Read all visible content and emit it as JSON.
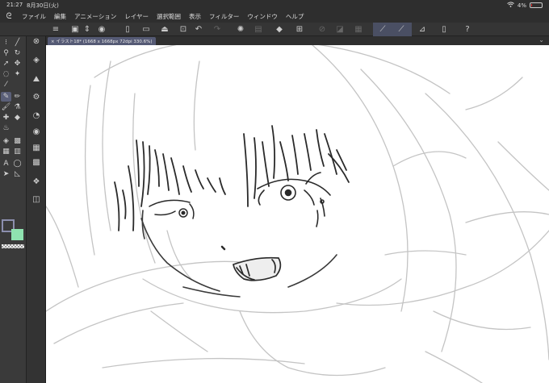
{
  "status": {
    "time": "21:27",
    "date": "8月30日(火)",
    "battery": "4%",
    "battery_level": 0.04
  },
  "menu": [
    {
      "id": "file",
      "label": "ファイル"
    },
    {
      "id": "edit",
      "label": "編集"
    },
    {
      "id": "animation",
      "label": "アニメーション"
    },
    {
      "id": "layer",
      "label": "レイヤー"
    },
    {
      "id": "selection",
      "label": "選択範囲"
    },
    {
      "id": "view",
      "label": "表示"
    },
    {
      "id": "filter",
      "label": "フィルター"
    },
    {
      "id": "window",
      "label": "ウィンドウ"
    },
    {
      "id": "help",
      "label": "ヘルプ"
    }
  ],
  "document_tab": {
    "label": "イラスト18* (1668 x 1668px 72dpi 330.6%)",
    "close_glyph": "×"
  },
  "colors": {
    "main": "#3a3a3a",
    "sub": "#8fe3b0",
    "accent": "#555a75"
  },
  "icons": {
    "logo": "clip-studio-logo",
    "commands": [
      "menu-icon",
      "new-document-icon",
      "open-file-icon",
      "save-icon",
      "import-icon",
      "undo-icon",
      "redo-icon",
      "loading-icon",
      "clear-icon",
      "fill-icon",
      "crop-icon",
      "transform-icon",
      "snap-ruler-icon",
      "snap-special-ruler-icon",
      "snap-grid-icon",
      "device-icon",
      "help-icon"
    ]
  }
}
